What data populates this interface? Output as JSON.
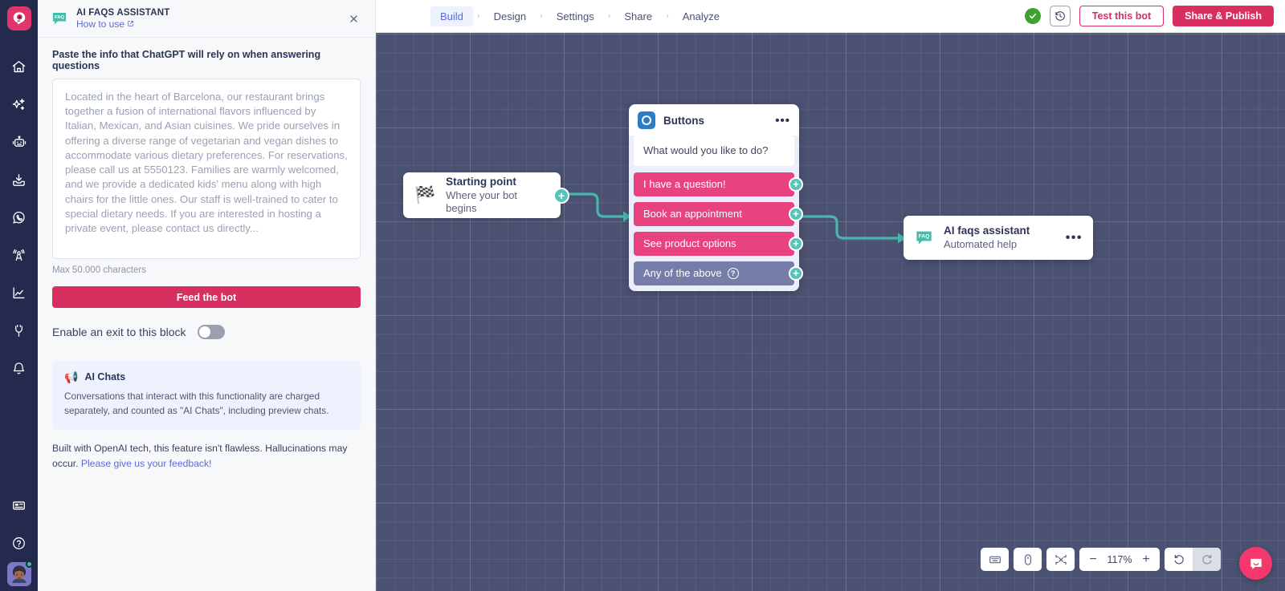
{
  "app": {
    "logo_name": "botmaker-logo"
  },
  "rail": {
    "items": [
      {
        "name": "home-icon",
        "label": "Home"
      },
      {
        "name": "sparkles-icon",
        "label": "AI"
      },
      {
        "name": "robot-icon",
        "label": "Bots"
      },
      {
        "name": "inbox-download-icon",
        "label": "Inbox"
      },
      {
        "name": "whatsapp-icon",
        "label": "WhatsApp"
      },
      {
        "name": "broadcast-tower-icon",
        "label": "Broadcast"
      },
      {
        "name": "analytics-chart-icon",
        "label": "Analytics"
      },
      {
        "name": "plug-icon",
        "label": "Integrations"
      },
      {
        "name": "bell-icon",
        "label": "Notifications"
      }
    ],
    "bottom_items": [
      {
        "name": "news-card-icon",
        "label": "News"
      },
      {
        "name": "help-circle-icon",
        "label": "Help"
      }
    ],
    "avatar_name": "user-avatar",
    "status": "online"
  },
  "panel": {
    "badge": "FAQ",
    "title": "AI FAQS ASSISTANT",
    "how_to_use": "How to use",
    "close_label": "✕",
    "field_label": "Paste the info that ChatGPT will rely on when answering questions",
    "textarea_value": "Located in the heart of Barcelona, our restaurant brings together a fusion of international flavors influenced by Italian, Mexican, and Asian cuisines. We pride ourselves in offering a diverse range of vegetarian and vegan dishes to accommodate various dietary preferences. For reservations, please call us at 5550123. Families are warmly welcomed, and we provide a dedicated kids' menu along with high chairs for the little ones. Our staff is well-trained to cater to special dietary needs. If you are interested in hosting a private event, please contact us directly...",
    "max_chars_hint": "Max 50.000 characters",
    "feed_button": "Feed the bot",
    "exit_toggle_label": "Enable an exit to this block",
    "exit_toggle_state": "off",
    "notice": {
      "icon": "megaphone-icon",
      "title": "AI Chats",
      "text": "Conversations that interact with this functionality are charged separately, and counted as \"AI Chats\", including preview chats."
    },
    "disclaimer_text": "Built with OpenAI tech, this feature isn't flawless. Hallucinations may occur. ",
    "disclaimer_link": "Please give us your feedback!"
  },
  "topbar": {
    "tabs": [
      {
        "label": "Build",
        "active": true
      },
      {
        "label": "Design",
        "active": false
      },
      {
        "label": "Settings",
        "active": false
      },
      {
        "label": "Share",
        "active": false
      },
      {
        "label": "Analyze",
        "active": false
      }
    ],
    "separator": "›",
    "saved_status": "saved-check",
    "history_icon": "history-clock-icon",
    "test_button": "Test this bot",
    "publish_button": "Share & Publish"
  },
  "canvas": {
    "start_node": {
      "icon": "🏁",
      "title": "Starting point",
      "subtitle": "Where your bot begins",
      "connector": "+"
    },
    "buttons_node": {
      "icon_name": "buttons-block-icon",
      "title": "Buttons",
      "menu": "•••",
      "prompt": "What would you like to do?",
      "options": [
        {
          "label": "I have a question!",
          "style": "pink",
          "connector": "+",
          "has_help": false
        },
        {
          "label": "Book an appointment",
          "style": "pink",
          "connector": "+",
          "has_help": false
        },
        {
          "label": "See product options",
          "style": "pink",
          "connector": "+",
          "has_help": false
        },
        {
          "label": "Any of the above",
          "style": "grey",
          "connector": "+",
          "has_help": true
        }
      ]
    },
    "faq_node": {
      "badge": "FAQ",
      "title": "AI faqs assistant",
      "subtitle": "Automated help",
      "menu": "•••"
    },
    "toolbar": {
      "keyboard_icon": "keyboard-icon",
      "mouse_icon": "mouse-icon",
      "fit_icon": "fit-to-screen-icon",
      "zoom_out": "−",
      "zoom_level": "117%",
      "zoom_in": "+",
      "undo_icon": "undo-icon",
      "redo_icon": "redo-icon",
      "redo_disabled": true
    },
    "chat_widget": "messenger-bubble-icon"
  },
  "colors": {
    "brand_pink": "#d82e60",
    "accent_indigo": "#5b6ae0",
    "canvas_bg": "#4b5171",
    "rail_bg": "#232a4d",
    "teal": "#56c4bb",
    "option_pink": "#e8437e",
    "option_grey": "#757da8",
    "success_green": "#3fa22f"
  }
}
